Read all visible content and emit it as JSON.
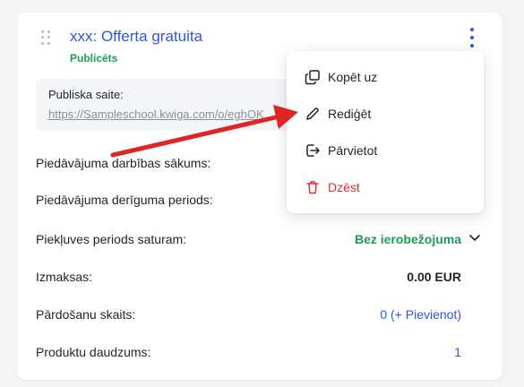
{
  "offer": {
    "title": "xxx: Offerta gratuita",
    "status": "Publicēts"
  },
  "public_link": {
    "label": "Publiska saite:",
    "url": "https://Sampleschool.kwiga.com/o/eghOK"
  },
  "rows": [
    {
      "label": "Piedāvājuma darbības sākums:",
      "value": ""
    },
    {
      "label": "Piedāvājuma derīguma periods:",
      "value": ""
    },
    {
      "label": "Piekļuves periods saturam:",
      "value": "Bez ierobežojuma"
    },
    {
      "label": "Izmaksas:",
      "value": "0.00 EUR"
    },
    {
      "label": "Pārdošanu skaits:",
      "value_count": "0",
      "value_add": "(+ Pievienot)"
    },
    {
      "label": "Produktu daudzums:",
      "value": "1"
    }
  ],
  "menu": {
    "items": [
      {
        "label": "Kopēt uz",
        "icon": "copy-icon"
      },
      {
        "label": "Rediģēt",
        "icon": "pencil-icon"
      },
      {
        "label": "Pārvietot",
        "icon": "move-icon"
      },
      {
        "label": "Dzēst",
        "icon": "trash-icon"
      }
    ]
  },
  "colors": {
    "accent": "#2f56d9",
    "success": "#1e9b57",
    "danger": "#d9303d",
    "annotation_arrow": "#e02424"
  }
}
